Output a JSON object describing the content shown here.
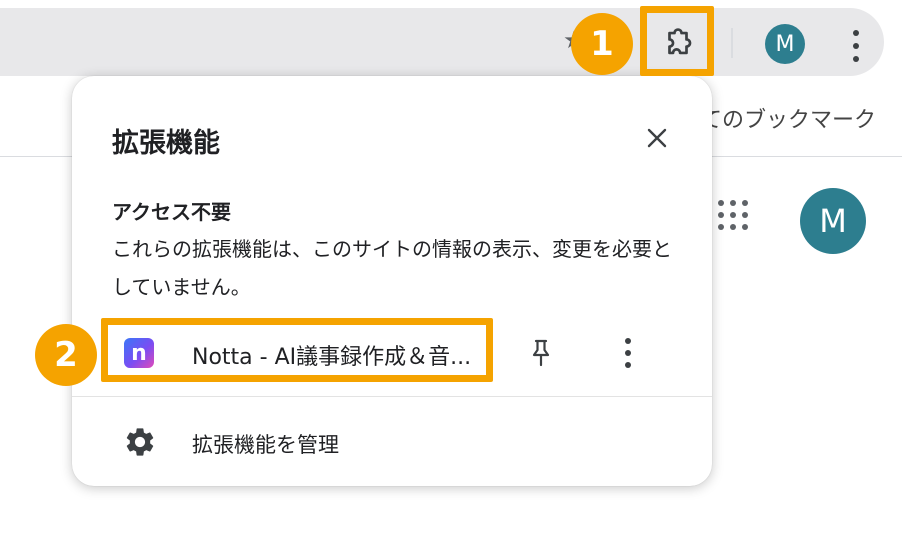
{
  "browser": {
    "profile_initial": "M",
    "bookmarks_bar_text": "てのブックマーク",
    "new_tab_profile_initial": "M"
  },
  "extensions_popup": {
    "title": "拡張機能",
    "section_heading": "アクセス不要",
    "section_description": "これらの拡張機能は、このサイトの情報の表示、変更を必要としていません。",
    "extensions": [
      {
        "name": "Notta - AI議事録作成＆音...",
        "logo_letter": "n"
      }
    ],
    "manage_label": "拡張機能を管理"
  },
  "callouts": [
    {
      "number": "1"
    },
    {
      "number": "2"
    }
  ],
  "colors": {
    "callout": "#f5a300",
    "avatar": "#2d7e8f",
    "chrome_bar": "#e8e8ea"
  },
  "icons": [
    "star-icon",
    "puzzle-icon",
    "menu-icon",
    "apps-icon",
    "close-icon",
    "pin-icon",
    "more-icon",
    "gear-icon"
  ]
}
